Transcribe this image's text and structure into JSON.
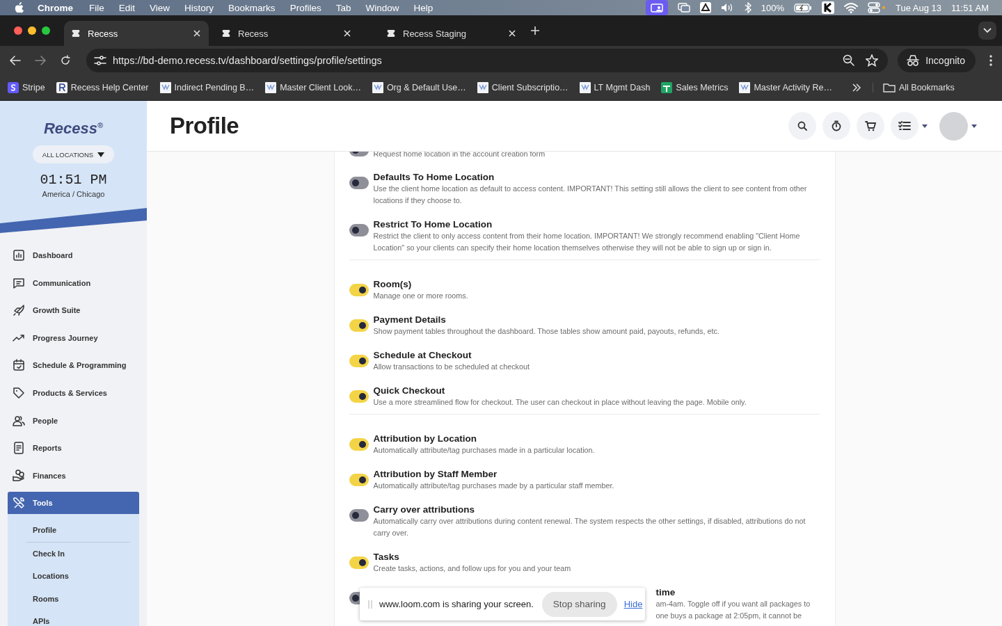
{
  "menu_bar": {
    "app": "Chrome",
    "menus": [
      "File",
      "Edit",
      "View",
      "History",
      "Bookmarks",
      "Profiles",
      "Tab",
      "Window",
      "Help"
    ],
    "battery": "100%",
    "date": "Tue Aug 13",
    "time": "11:51 AM"
  },
  "browser": {
    "tabs": [
      {
        "title": "Recess",
        "selected": true
      },
      {
        "title": "Recess",
        "selected": false
      },
      {
        "title": "Recess Staging",
        "selected": false
      }
    ],
    "url": "https://bd-demo.recess.tv/dashboard/settings/profile/settings",
    "profile": "Incognito",
    "bookmarks": [
      {
        "label": "Stripe",
        "kind": "stripe"
      },
      {
        "label": "Recess Help Center",
        "kind": "letter"
      },
      {
        "label": "Indirect Pending B…",
        "kind": "page"
      },
      {
        "label": "Master Client Look…",
        "kind": "page"
      },
      {
        "label": "Org & Default Use…",
        "kind": "page"
      },
      {
        "label": "Client Subscriptio…",
        "kind": "page"
      },
      {
        "label": "LT Mgmt Dash",
        "kind": "page"
      },
      {
        "label": "Sales Metrics",
        "kind": "sheet"
      },
      {
        "label": "Master Activity Re…",
        "kind": "page"
      }
    ],
    "all_bookmarks": "All Bookmarks"
  },
  "sidebar": {
    "logo": "Recess$^{®}$",
    "location_filter": "ALL LOCATIONS",
    "clock": "01:51 PM",
    "timezone": "America / Chicago",
    "items": [
      {
        "label": "Dashboard",
        "selected": false
      },
      {
        "label": "Communication",
        "selected": false
      },
      {
        "label": "Growth Suite",
        "selected": false
      },
      {
        "label": "Progress Journey",
        "selected": false
      },
      {
        "label": "Schedule & Programming",
        "selected": false
      },
      {
        "label": "Products & Services",
        "selected": false
      },
      {
        "label": "People",
        "selected": false
      },
      {
        "label": "Reports",
        "selected": false
      },
      {
        "label": "Finances",
        "selected": false
      },
      {
        "label": "Tools",
        "selected": true
      }
    ],
    "sub_items": [
      {
        "label": "Profile",
        "selected": false
      },
      {
        "label": "Check In",
        "selected": false
      },
      {
        "label": "Locations",
        "selected": false
      },
      {
        "label": "Rooms",
        "selected": false
      },
      {
        "label": "APIs",
        "selected": false
      }
    ]
  },
  "header": {
    "title": "Profile"
  },
  "settings": [
    {
      "kind": "toggle",
      "description": "Request home location in the account creation form",
      "on": false
    },
    {
      "kind": "toggle",
      "title": "Defaults To Home Location",
      "description": "Use the client home location as default to access content. IMPORTANT! This setting still allows the client to see content from other locations if they choose to.",
      "on": false
    },
    {
      "kind": "toggle",
      "title": "Restrict To Home Location",
      "description": "Restrict the client to only access content from their home location. IMPORTANT! We strongly recommend enabling \"Client Home Location\" so your clients can specify their home location themselves otherwise they will not be able to sign up or sign in.",
      "on": false
    },
    {
      "kind": "divider"
    },
    {
      "kind": "toggle",
      "title": "Room(s)",
      "description": "Manage one or more rooms.",
      "on": true
    },
    {
      "kind": "toggle",
      "title": "Payment Details",
      "description": "Show payment tables throughout the dashboard. Those tables show amount paid, payouts, refunds, etc.",
      "on": true
    },
    {
      "kind": "toggle",
      "title": "Schedule at Checkout",
      "description": "Allow transactions to be scheduled at checkout",
      "on": true
    },
    {
      "kind": "toggle",
      "title": "Quick Checkout",
      "description": "Use a more streamlined flow for checkout. The user can checkout in place without leaving the page. Mobile only.",
      "on": true
    },
    {
      "kind": "divider"
    },
    {
      "kind": "toggle",
      "title": "Attribution by Location",
      "description": "Automatically attribute/tag purchases made in a particular location.",
      "on": true
    },
    {
      "kind": "toggle",
      "title": "Attribution by Staff Member",
      "description": "Automatically attribute/tag purchases made by a particular staff member.",
      "on": true
    },
    {
      "kind": "toggle",
      "title": "Carry over attributions",
      "description": "Automatically carry over attributions during content renewal. The system respects the other settings, if disabled, attributions do not carry over.",
      "on": false
    },
    {
      "kind": "toggle",
      "title": "Tasks",
      "description": "Create tasks, actions, and follow ups for you and your team",
      "on": true
    },
    {
      "kind": "partial",
      "title": "time",
      "fragments": [
        "am-4am. Toggle off if you want all packages to",
        "one buys a package at 2:05pm, it cannot be"
      ],
      "on": false
    }
  ],
  "notice": {
    "text": "www.loom.com is sharing your screen.",
    "stop": "Stop sharing",
    "hide": "Hide"
  }
}
